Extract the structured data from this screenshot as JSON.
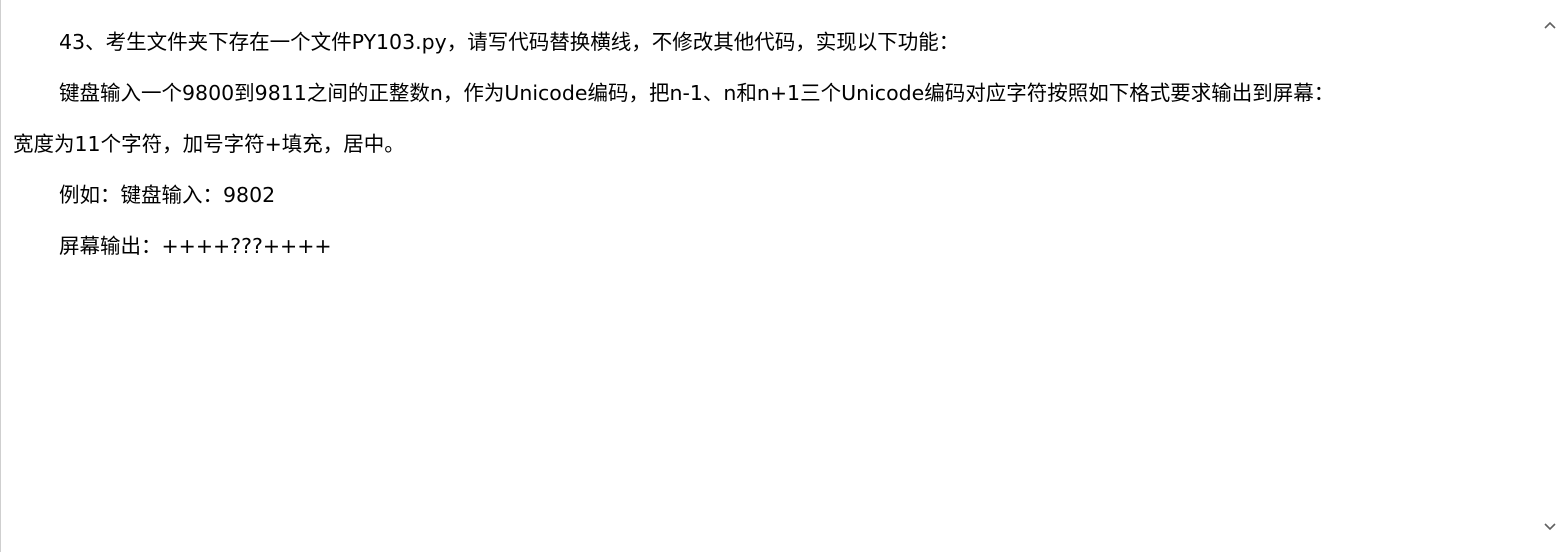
{
  "document": {
    "paragraphs": [
      "43、考生文件夹下存在一个文件PY103.py，请写代码替换横线，不修改其他代码，实现以下功能：",
      "键盘输入一个9800到9811之间的正整数n，作为Unicode编码，把n-1、n和n+1三个Unicode编码对应字符按照如下格式要求输出到屏幕：",
      "宽度为11个字符，加号字符+填充，居中。",
      "例如：键盘输入：9802",
      "屏幕输出：++++???++++"
    ]
  },
  "scrollbar": {
    "up_icon": "chevron-up-icon",
    "down_icon": "chevron-down-icon"
  }
}
